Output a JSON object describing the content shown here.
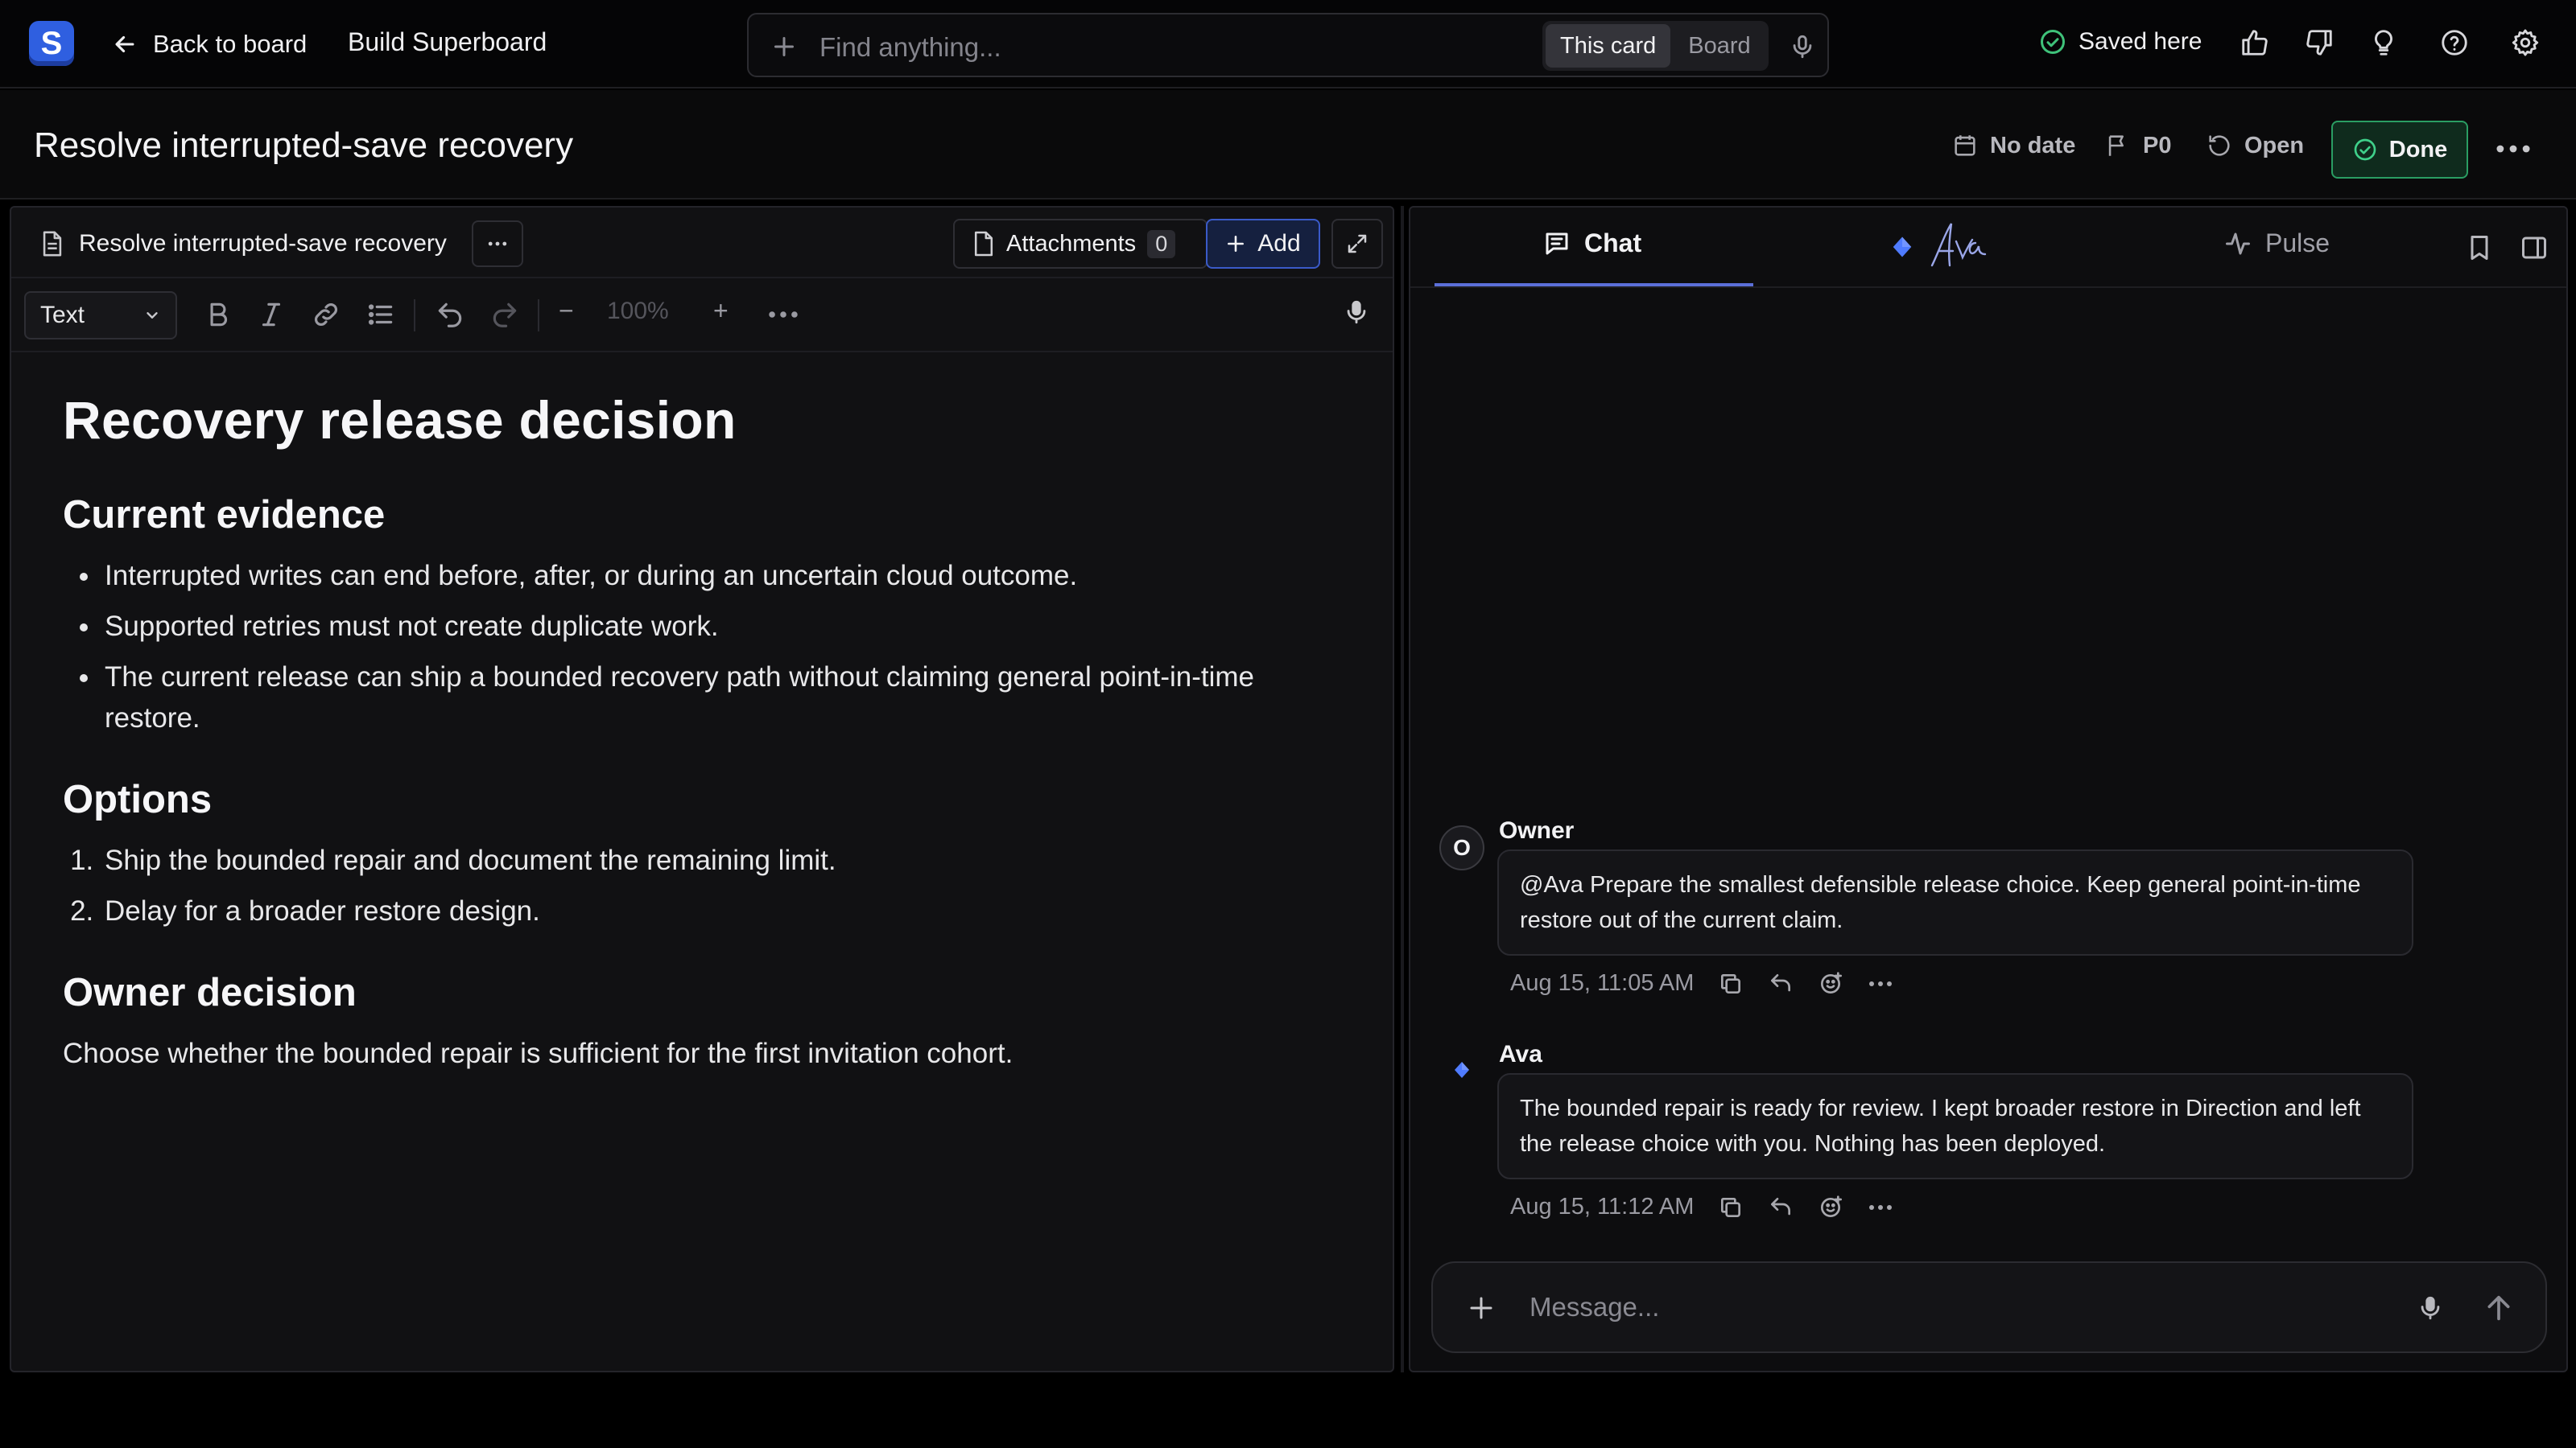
{
  "topbar": {
    "logo_letter": "S",
    "back_label": "Back to board",
    "board_name": "Build Superboard",
    "search": {
      "placeholder": "Find anything...",
      "scopes": [
        "This card",
        "Board"
      ],
      "active_scope": "This card"
    },
    "saved_label": "Saved here",
    "icons": [
      "thumbs-up-icon",
      "thumbs-down-icon",
      "lightbulb-icon",
      "help-icon",
      "settings-icon"
    ]
  },
  "card": {
    "title": "Resolve interrupted-save recovery",
    "date": "No date",
    "priority": "P0",
    "status": "Open",
    "done_label": "Done"
  },
  "editor": {
    "doc_tab": "Resolve interrupted-save recovery",
    "attachments_label": "Attachments",
    "attachments_count": "0",
    "add_label": "Add",
    "block_type": "Text",
    "zoom": "100%",
    "zoom_minus": "−",
    "zoom_plus": "+",
    "heading": "Recovery release decision",
    "sections": {
      "evidence": {
        "title": "Current evidence",
        "items": [
          "Interrupted writes can end before, after, or during an uncertain cloud outcome.",
          "Supported retries must not create duplicate work.",
          "The current release can ship a bounded recovery path without claiming general point-in-time restore."
        ]
      },
      "options": {
        "title": "Options",
        "items": [
          "Ship the bounded repair and document the remaining limit.",
          "Delay for a broader restore design."
        ]
      },
      "decision": {
        "title": "Owner decision",
        "text": "Choose whether the bounded repair is sufficient for the first invitation cohort."
      }
    }
  },
  "panel": {
    "tabs": {
      "chat": "Chat",
      "ava": "Ava",
      "pulse": "Pulse"
    },
    "messages": [
      {
        "initial": "O",
        "author": "Owner",
        "text": "@Ava Prepare the smallest defensible release choice. Keep general point-in-time restore out of the current claim.",
        "time": "Aug 15, 11:05 AM"
      },
      {
        "author": "Ava",
        "text": "The bounded repair is ready for review. I kept broader restore in Direction and left the release choice with you. Nothing has been deployed.",
        "time": "Aug 15, 11:12 AM"
      }
    ],
    "composer_placeholder": "Message..."
  },
  "colors": {
    "accent_blue": "#2f5fe0",
    "done_green": "#2a9d63",
    "tab_indicator": "#5b6fd8",
    "ava_diamond": "#4f7bff"
  }
}
